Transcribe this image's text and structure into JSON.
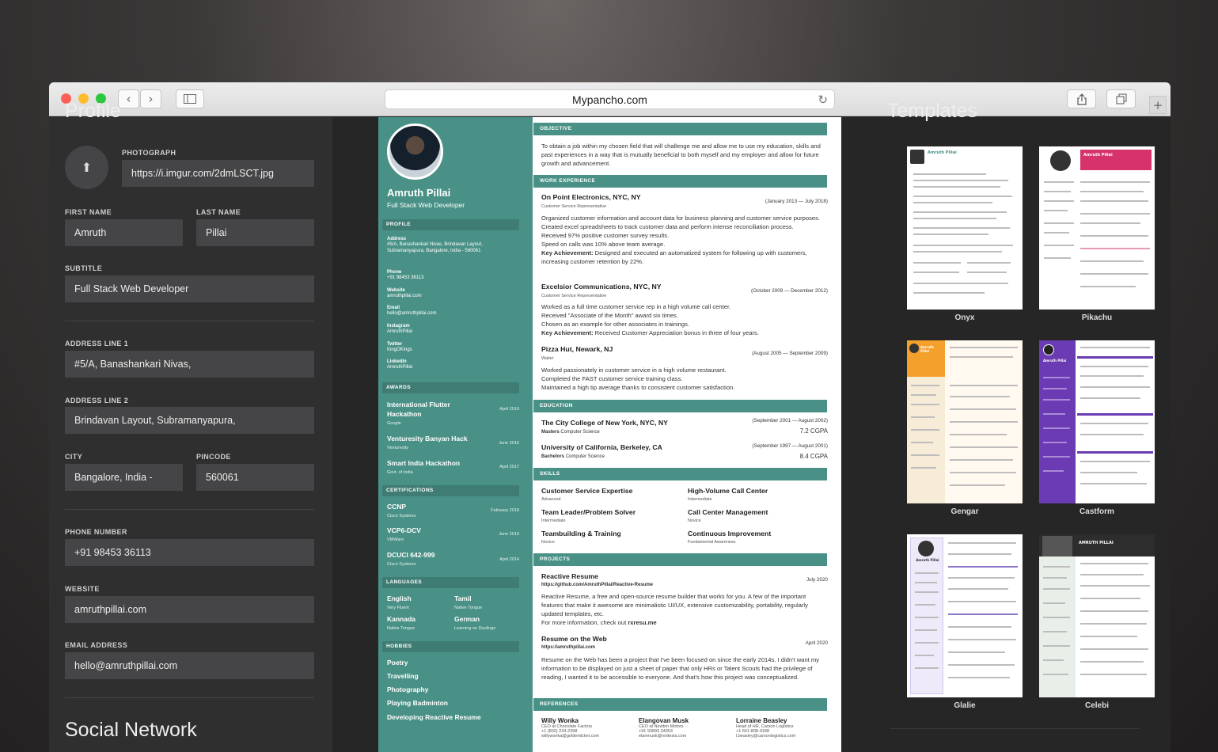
{
  "browser": {
    "url": "Mypancho.com"
  },
  "form": {
    "section_title": "Profile",
    "photo_label": "PHOTOGRAPH",
    "photo_value": "https://i.imgur.com/2dmLSCT.jpg",
    "first_name_label": "FIRST NAME",
    "first_name": "Amruth",
    "last_name_label": "LAST NAME",
    "last_name": "Pillai",
    "subtitle_label": "SUBTITLE",
    "subtitle": "Full Stack Web Developer",
    "address1_label": "ADDRESS LINE 1",
    "address1": "#5/A, Banashankari Nivas,",
    "address2_label": "ADDRESS LINE 2",
    "address2": "Brindavan Layout, Subramanyapura,",
    "city_label": "CITY",
    "city": "Bangalore, India -",
    "pincode_label": "PINCODE",
    "pincode": "560061",
    "phone_label": "PHONE NUMBER",
    "phone": "+91 98453 36113",
    "website_label": "WEBSITE",
    "website": "amruthpillai.com",
    "email_label": "EMAIL ADDRESS",
    "email": "hello@amruthpillai.com",
    "social_title": "Social Network"
  },
  "resume": {
    "name": "Amruth Pillai",
    "subtitle": "Full Stack Web Developer",
    "sidebar": {
      "profile_title": "PROFILE",
      "profile": [
        {
          "label": "Address",
          "value": "#5/A, Banashankari Nivas, Brindavan Layout, Subramanyapura, Bangalore, India - 560061"
        },
        {
          "label": "Phone",
          "value": "+91 98453 36113"
        },
        {
          "label": "Website",
          "value": "amruthpillai.com"
        },
        {
          "label": "Email",
          "value": "hello@amruthpillai.com"
        },
        {
          "label": "Instagram",
          "value": "AmruthPillai"
        },
        {
          "label": "Twitter",
          "value": "KingOKings"
        },
        {
          "label": "LinkedIn",
          "value": "AmruthPillai"
        }
      ],
      "awards_title": "AWARDS",
      "awards": [
        {
          "title": "International Flutter Hackathon",
          "sub": "Google",
          "date": "April 2019"
        },
        {
          "title": "Venturesity Banyan Hack",
          "sub": "Venturesity",
          "date": "June 2016"
        },
        {
          "title": "Smart India Hackathon",
          "sub": "Govt. of India",
          "date": "April 2017"
        }
      ],
      "certs_title": "CERTIFICATIONS",
      "certs": [
        {
          "title": "CCNP",
          "sub": "Cisco Systems",
          "date": "February 2018"
        },
        {
          "title": "VCP6-DCV",
          "sub": "VMWare",
          "date": "June 2019"
        },
        {
          "title": "DCUCI 642-999",
          "sub": "Cisco Systems",
          "date": "April 2014"
        }
      ],
      "languages_title": "LANGUAGES",
      "languages": [
        {
          "name": "English",
          "level": "Very Fluent"
        },
        {
          "name": "Tamil",
          "level": "Native Tongue"
        },
        {
          "name": "Kannada",
          "level": "Native Tongue"
        },
        {
          "name": "German",
          "level": "Learning on Duolingo"
        }
      ],
      "hobbies_title": "HOBBIES",
      "hobbies": [
        "Poetry",
        "Travelling",
        "Photography",
        "Playing Badminton",
        "Developing Reactive Resume"
      ]
    },
    "objective_title": "OBJECTIVE",
    "objective": "To obtain a job within my chosen field that will challenge me and allow me to use my education, skills and past experiences in a way that is mutually beneficial to both myself and my employer and allow for future growth and advancement.",
    "work_title": "WORK EXPERIENCE",
    "work": [
      {
        "title": "On Point Electronics, NYC, NY",
        "role": "Customer Service Representative",
        "date": "(January 2013 — July 2018)",
        "lines": [
          "Organized customer information and account data for business planning and customer service purposes.",
          "Created excel spreadsheets to track customer data and perform intense reconciliation process.",
          "Received 97% positive customer survey results.",
          "Speed on calls was 10% above team average."
        ],
        "key_label": "Key Achievement:",
        "key": " Designed and executed an automatized system for following up with customers, increasing customer retention by 22%."
      },
      {
        "title": "Excelsior Communications, NYC, NY",
        "role": "Customer Service Representative",
        "date": "(October 2009 — December 2012)",
        "lines": [
          "Worked as a full time customer service rep in a high volume call center.",
          "Received \"Associate of the Month\" award six times.",
          "Chosen as an example for other associates in trainings."
        ],
        "key_label": "Key Achievement:",
        "key": " Received Customer Appreciation bonus in three of four years."
      },
      {
        "title": "Pizza Hut, Newark, NJ",
        "role": "Waiter",
        "date": "(August 2005 — September 2009)",
        "lines": [
          "Worked passionately in customer service in a high volume restaurant.",
          "Completed the FAST customer service training class.",
          "Maintained a high tip average thanks to consistent customer satisfaction."
        ]
      }
    ],
    "education_title": "EDUCATION",
    "education": [
      {
        "school": "The City College of New York, NYC, NY",
        "degree": "Masters",
        "field": "Computer Science",
        "date": "(September 2001 — August 2002)",
        "grade": "7.2 CGPA"
      },
      {
        "school": "University of California, Berkeley, CA",
        "degree": "Bachelors",
        "field": "Computer Science",
        "date": "(September 1997 — August 2001)",
        "grade": "8.4 CGPA"
      }
    ],
    "skills_title": "SKILLS",
    "skills": [
      {
        "name": "Customer Service Expertise",
        "level": "Advanced"
      },
      {
        "name": "High-Volume Call Center",
        "level": "Intermediate"
      },
      {
        "name": "Team Leader/Problem Solver",
        "level": "Intermediate"
      },
      {
        "name": "Call Center Management",
        "level": "Novice"
      },
      {
        "name": "Teambuilding & Training",
        "level": "Novice"
      },
      {
        "name": "Continuous Improvement",
        "level": "Fundamental Awareness"
      }
    ],
    "projects_title": "PROJECTS",
    "projects": [
      {
        "title": "Reactive Resume",
        "link": "https://github.com/AmruthPillai/Reactive-Resume",
        "date": "July 2020",
        "text": "Reactive Resume, a free and open-source resume builder that works for you. A few of the important features that make it awesome are minimalistic UI/UX, extensive customizability, portability, regularly updated templates, etc.",
        "more": "For more information, check out ",
        "more_link": "rxresu.me"
      },
      {
        "title": "Resume on the Web",
        "link": "https://amruthpillai.com",
        "date": "April 2020",
        "text": "Resume on the Web has been a project that I've been focused on since the early 2014s. I didn't want my information to be displayed on just a sheet of paper that only HRs or Talent Scouts had the privilege of reading, I wanted it to be accessible to everyone. And that's how this project was conceptualized."
      }
    ],
    "references_title": "REFERENCES",
    "references": [
      {
        "name": "Willy Wonka",
        "role": "CEO at Chocolate Factory",
        "phone": "+1 (802) 234-2398",
        "email": "willywonka@goldenticket.com"
      },
      {
        "name": "Elangovan Musk",
        "role": "CEO at Newton Motors",
        "phone": "+91 93893 34353",
        "email": "elanmusk@nottesla.com"
      },
      {
        "name": "Lorraine Beasley",
        "role": "Head of HR, Carson Logistics",
        "phone": "+1 661-808-4188",
        "email": "l.beasley@carsonlogistics.com"
      }
    ]
  },
  "templates": {
    "title": "Templates",
    "items": [
      "Onyx",
      "Pikachu",
      "Gengar",
      "Castform",
      "Glalie",
      "Celebi"
    ],
    "mini": {
      "onyx": "Amruth Pillai",
      "pikachu": "Amruth Pillai",
      "gengar": "Amruth Pillai",
      "castform": "Amruth Pillai",
      "glalie": "Amruth Pillai",
      "celebi": "AMRUTH PILLAI"
    }
  },
  "colors": {
    "accent": "#499186",
    "accent_dark": "#3f7d74",
    "panel": "#2f2f30",
    "input": "#454547",
    "pikachu": "#d6336c",
    "gengar": "#f3a02c",
    "castform": "#6a3bb3",
    "glalie": "#efeaf9"
  }
}
